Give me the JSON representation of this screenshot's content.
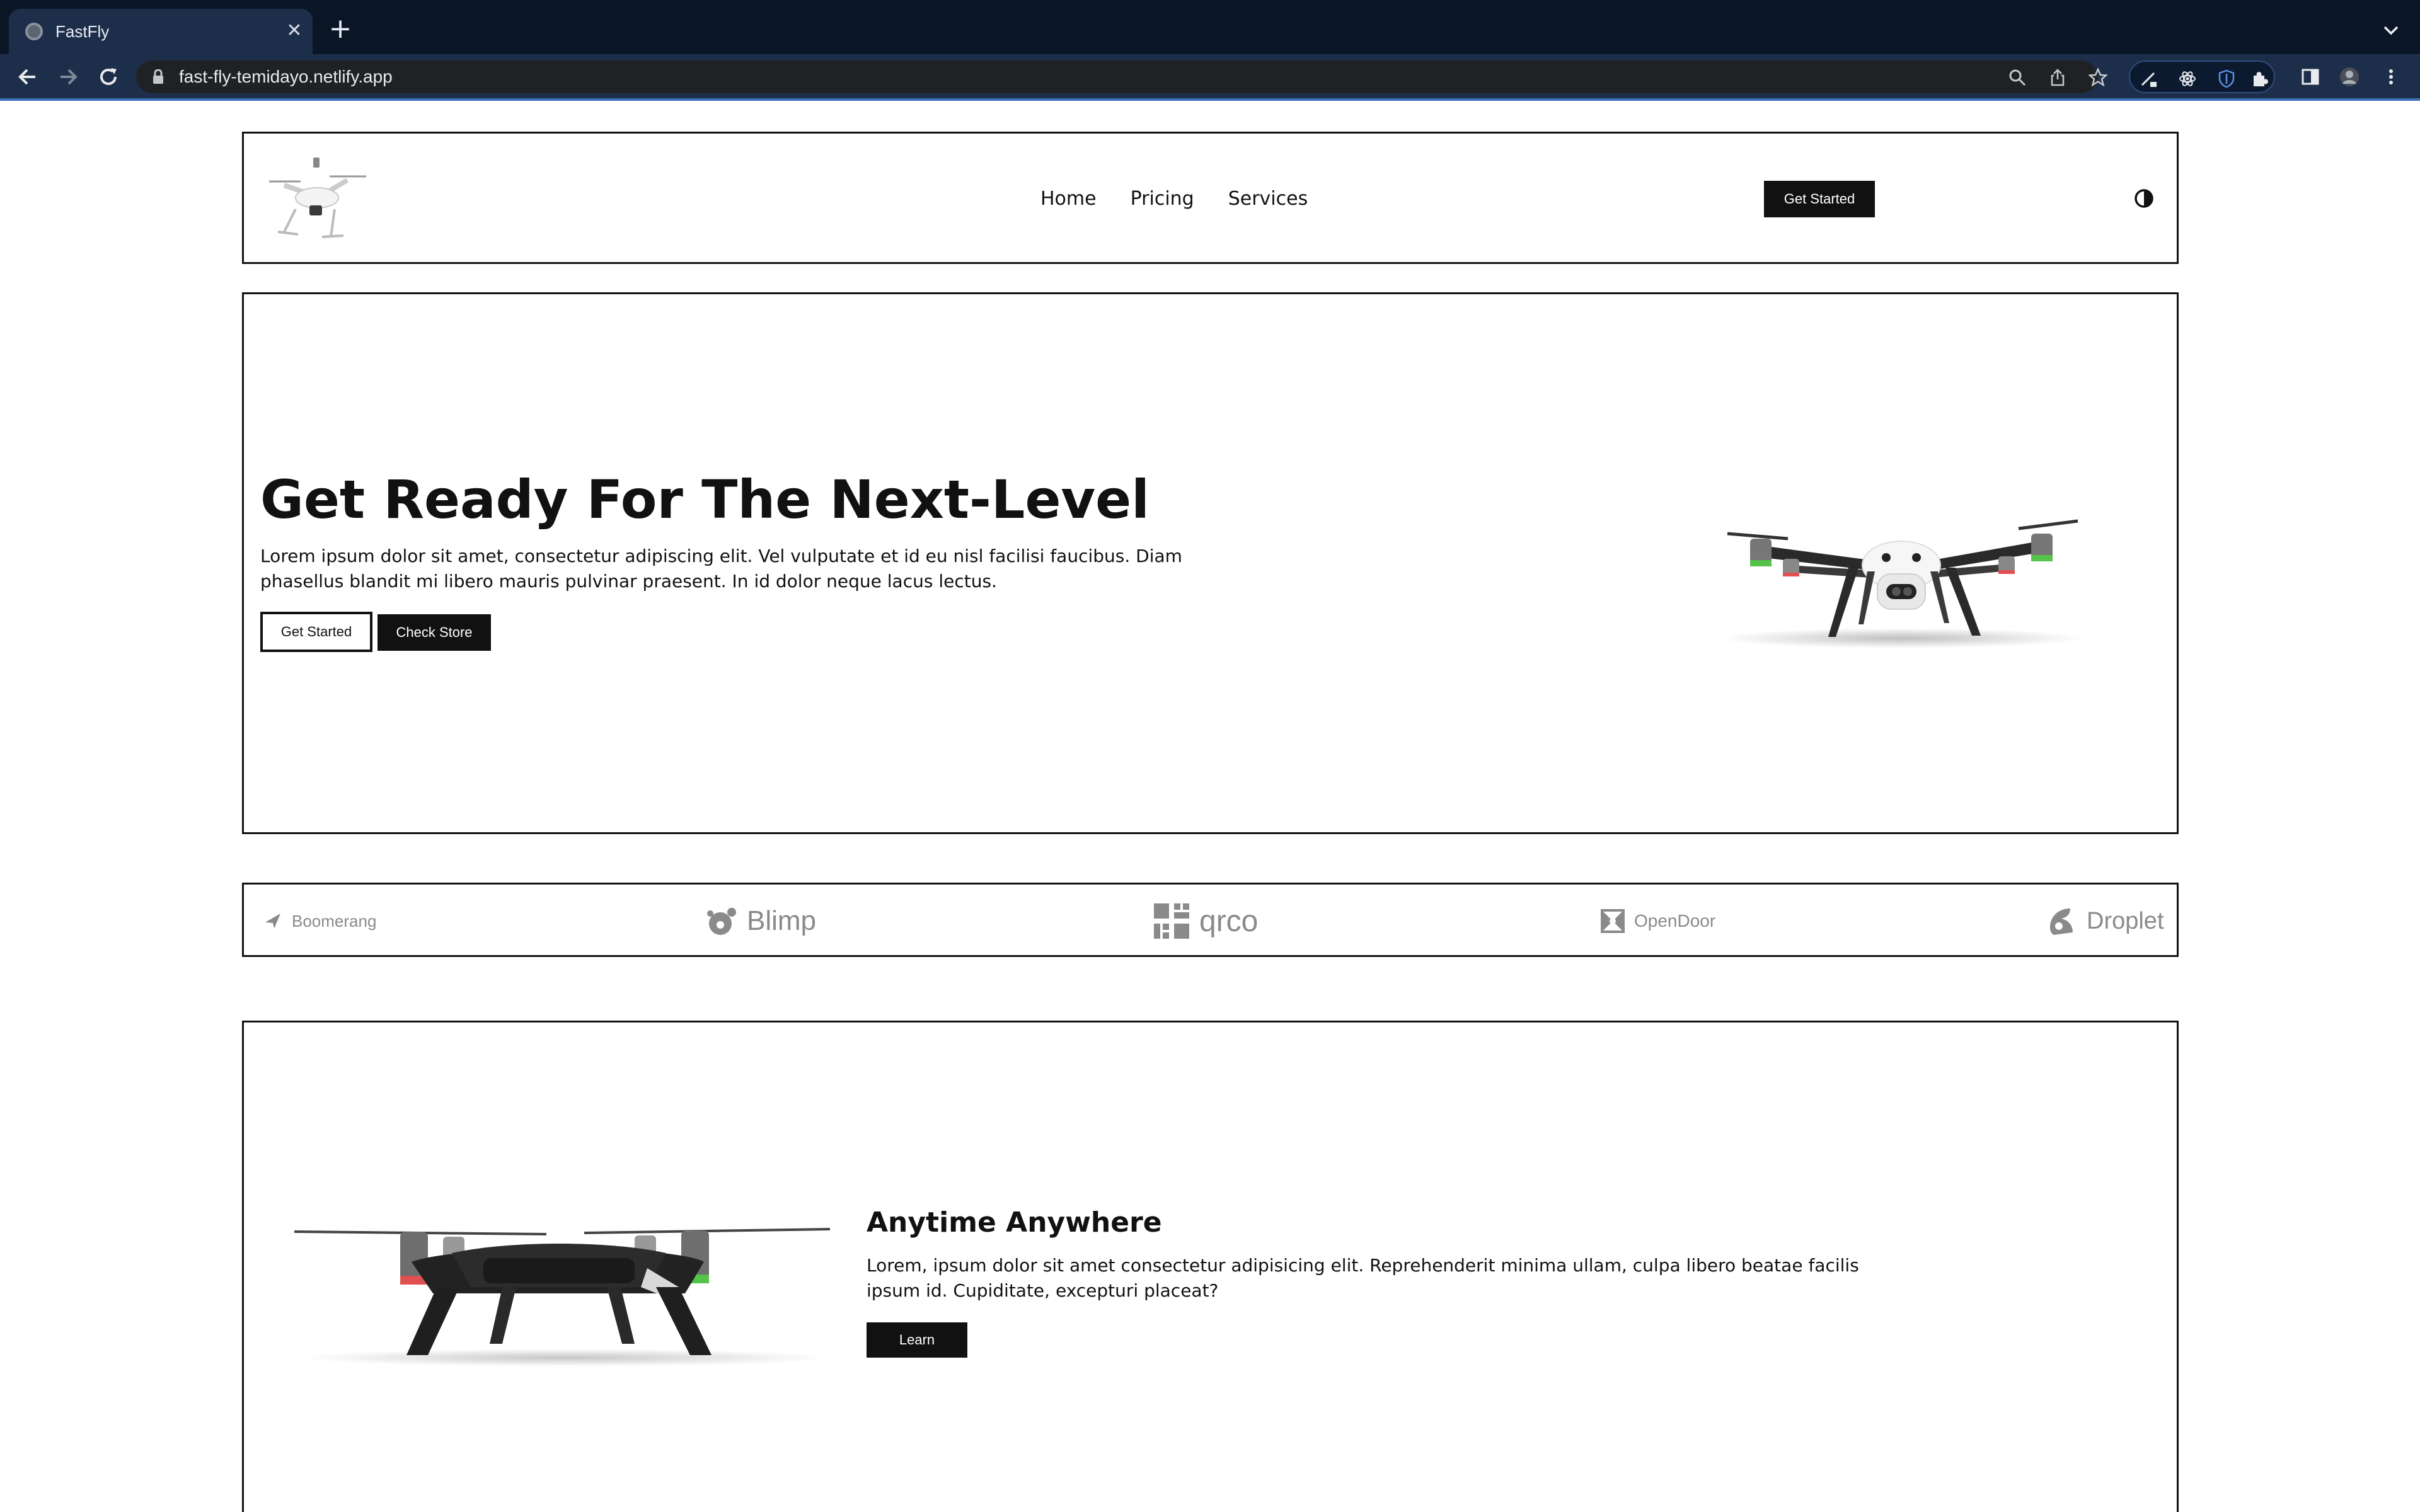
{
  "browser": {
    "tab_title": "FastFly",
    "url": "fast-fly-temidayo.netlify.app"
  },
  "navbar": {
    "links": [
      "Home",
      "Pricing",
      "Services"
    ],
    "cta_label": "Get Started"
  },
  "hero": {
    "title": "Get Ready For The Next-Level",
    "text": "Lorem ipsum dolor sit amet, consectetur adipiscing elit. Vel vulputate et id eu nisl facilisi faucibus. Diam phasellus blandit mi libero mauris pulvinar praesent. In id dolor neque lacus lectus.",
    "primary_button": "Get Started",
    "secondary_button": "Check Store"
  },
  "brands": [
    "Boomerang",
    "Blimp",
    "qrco",
    "OpenDoor",
    "Droplet"
  ],
  "feature": {
    "title": "Anytime Anywhere",
    "text": "Lorem, ipsum dolor sit amet consectetur adipisicing elit. Reprehenderit minima ullam, culpa libero beatae facilis ipsum id. Cupiditate, excepturi placeat?",
    "button": "Learn"
  },
  "colors": {
    "browser_tabbar": "#0a1526",
    "browser_toolbar": "#1d2e4b",
    "text_dark": "#111111",
    "brand_gray": "#8a8a8a"
  }
}
